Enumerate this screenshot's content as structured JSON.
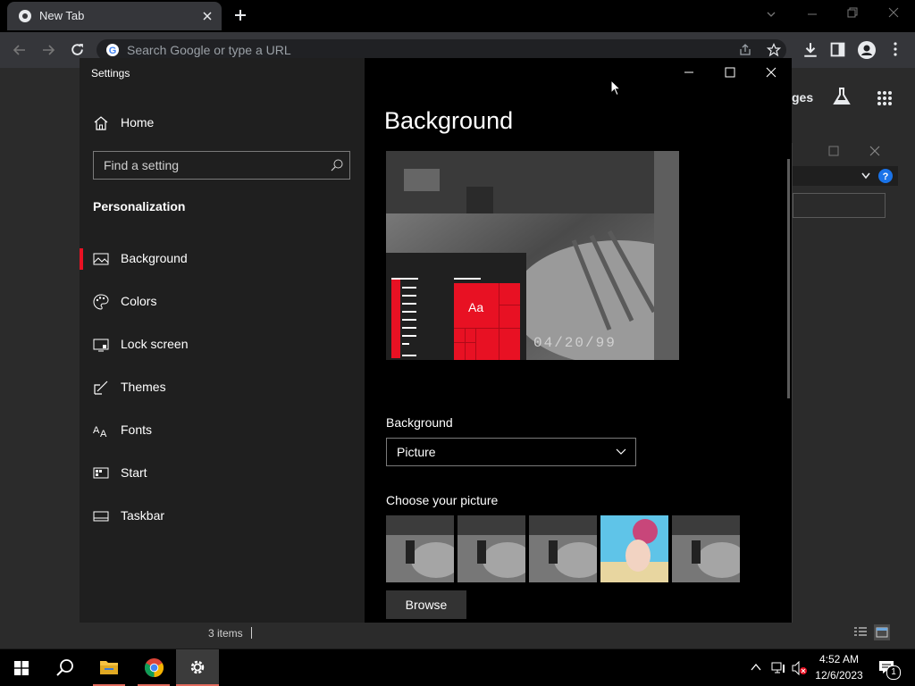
{
  "browser": {
    "tab_title": "New Tab",
    "omnibox_placeholder": "Search Google or type a URL",
    "right_partial_text": "ges"
  },
  "settings": {
    "window_title": "Settings",
    "home_label": "Home",
    "search_placeholder": "Find a setting",
    "section_title": "Personalization",
    "nav_items": [
      {
        "label": "Background",
        "icon": "picture-icon",
        "active": true
      },
      {
        "label": "Colors",
        "icon": "palette-icon",
        "active": false
      },
      {
        "label": "Lock screen",
        "icon": "lock-screen-icon",
        "active": false
      },
      {
        "label": "Themes",
        "icon": "brush-icon",
        "active": false
      },
      {
        "label": "Fonts",
        "icon": "font-icon",
        "active": false
      },
      {
        "label": "Start",
        "icon": "start-icon",
        "active": false
      },
      {
        "label": "Taskbar",
        "icon": "taskbar-icon",
        "active": false
      }
    ],
    "page_title": "Background",
    "preview": {
      "sample_text": "Aa",
      "timestamp_text": "04/20/99"
    },
    "background_label": "Background",
    "background_value": "Picture",
    "choose_picture_label": "Choose your picture",
    "browse_label": "Browse",
    "accent_color": "#e81123"
  },
  "explorer": {
    "item_count": "3 items"
  },
  "taskbar": {
    "time": "4:52 AM",
    "date": "12/6/2023",
    "notification_count": "1"
  }
}
